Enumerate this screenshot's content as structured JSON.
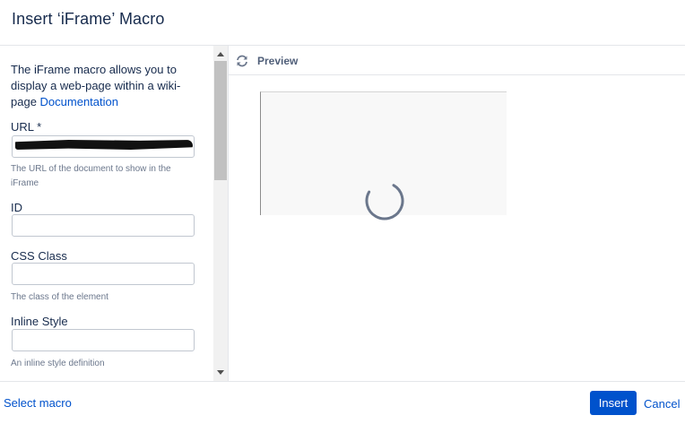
{
  "dialog": {
    "title": "Insert ‘iFrame’ Macro"
  },
  "form": {
    "description": "The iFrame macro allows you to display a web-page within a wiki-page",
    "documentation_link": "Documentation",
    "fields": [
      {
        "label": "URL *",
        "value": "",
        "help": "The URL of the document to show in the iFrame"
      },
      {
        "label": "ID",
        "value": "",
        "help": ""
      },
      {
        "label": "CSS Class",
        "value": "",
        "help": "The class of the element"
      },
      {
        "label": "Inline Style",
        "value": "",
        "help": "An inline style definition"
      }
    ]
  },
  "preview": {
    "label": "Preview",
    "icon": "refresh-icon",
    "state": "loading"
  },
  "footer": {
    "select_macro": "Select macro",
    "insert": "Insert",
    "cancel": "Cancel"
  },
  "colors": {
    "primary": "#0052cc",
    "text": "#172b4d",
    "muted": "#6b778c",
    "border": "#c1c7d0"
  }
}
